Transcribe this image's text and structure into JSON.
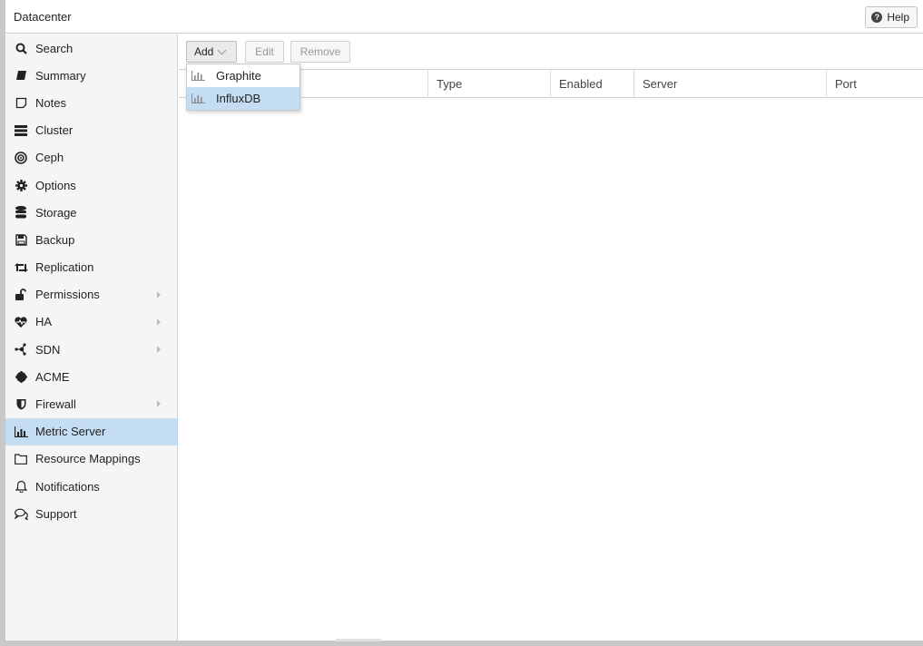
{
  "window": {
    "title": "Datacenter",
    "help_label": "Help"
  },
  "sidebar": {
    "items": [
      {
        "label": "Search",
        "icon": "search-icon",
        "glyph": "🔍"
      },
      {
        "label": "Summary",
        "icon": "book-icon",
        "glyph": "▰"
      },
      {
        "label": "Notes",
        "icon": "note-icon",
        "glyph": "☐"
      },
      {
        "label": "Cluster",
        "icon": "server-stack-icon",
        "glyph": "▤"
      },
      {
        "label": "Ceph",
        "icon": "ceph-icon",
        "glyph": "◉"
      },
      {
        "label": "Options",
        "icon": "gear-icon",
        "glyph": "✹"
      },
      {
        "label": "Storage",
        "icon": "database-icon",
        "glyph": "☰"
      },
      {
        "label": "Backup",
        "icon": "floppy-icon",
        "glyph": "▣"
      },
      {
        "label": "Replication",
        "icon": "retweet-icon",
        "glyph": "⇄"
      },
      {
        "label": "Permissions",
        "icon": "unlock-icon",
        "glyph": "🔓"
      },
      {
        "label": "HA",
        "icon": "heartbeat-icon",
        "glyph": "♥"
      },
      {
        "label": "SDN",
        "icon": "network-icon",
        "glyph": "⁂"
      },
      {
        "label": "ACME",
        "icon": "certificate-icon",
        "glyph": "●"
      },
      {
        "label": "Firewall",
        "icon": "shield-icon",
        "glyph": "◆"
      },
      {
        "label": "Metric Server",
        "icon": "bar-chart-icon",
        "glyph": "📊"
      },
      {
        "label": "Resource Mappings",
        "icon": "folder-icon",
        "glyph": "🗀"
      },
      {
        "label": "Notifications",
        "icon": "bell-icon",
        "glyph": "🔔"
      },
      {
        "label": "Support",
        "icon": "comments-icon",
        "glyph": "💬"
      }
    ],
    "selected": "Metric Server"
  },
  "toolbar": {
    "add_label": "Add",
    "edit_label": "Edit",
    "remove_label": "Remove"
  },
  "grid": {
    "columns": [
      "Type",
      "Enabled",
      "Server",
      "Port"
    ]
  },
  "add_menu": {
    "items": [
      {
        "label": "Graphite",
        "icon": "bar-chart-icon"
      },
      {
        "label": "InfluxDB",
        "icon": "bar-chart-icon"
      }
    ],
    "highlighted": "InfluxDB"
  },
  "colors": {
    "selection": "#c5ddf3",
    "sidebar_bg": "#f5f5f5",
    "border": "#cfcfcf"
  }
}
